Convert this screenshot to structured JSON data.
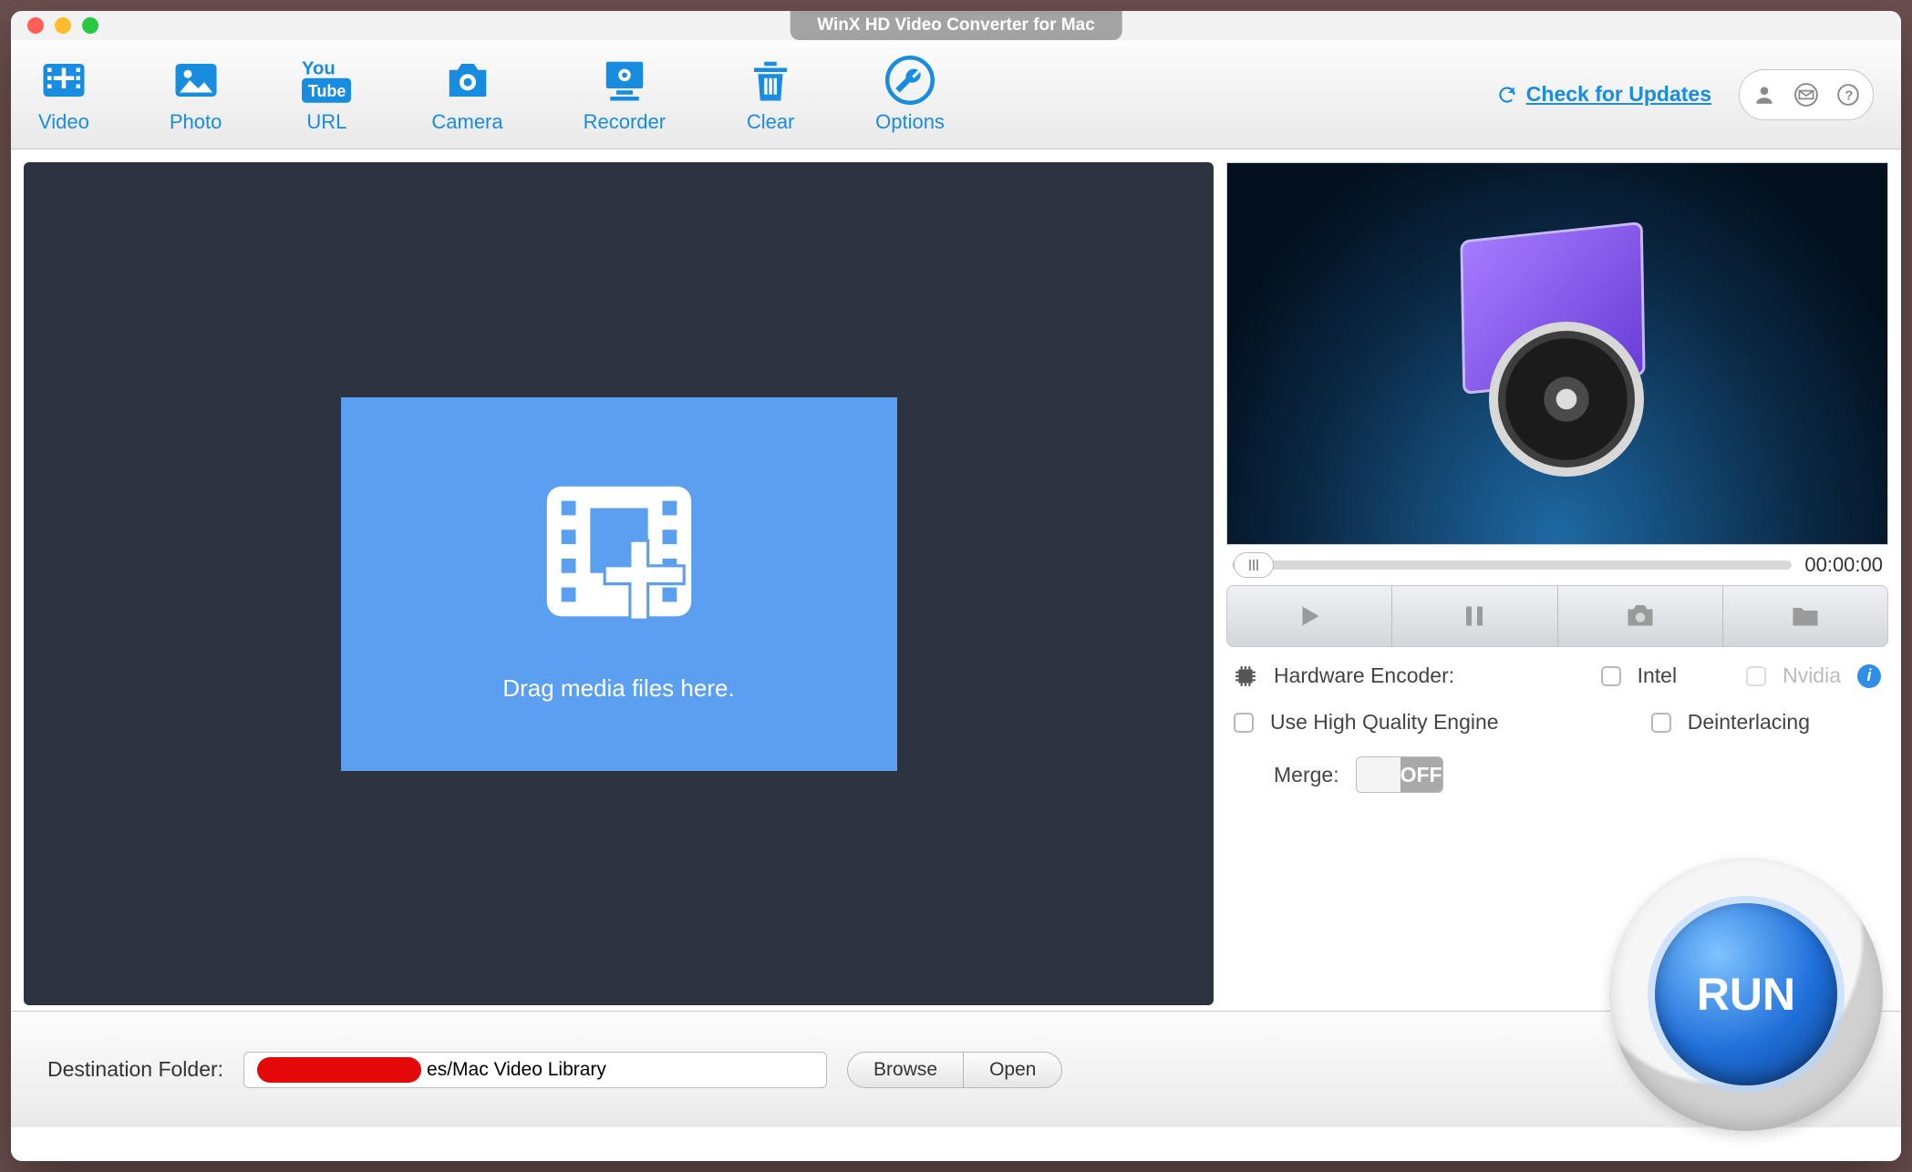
{
  "window": {
    "title": "WinX HD Video Converter for Mac"
  },
  "toolbar": {
    "items": [
      {
        "label": "Video",
        "icon": "video-add-icon"
      },
      {
        "label": "Photo",
        "icon": "photo-icon"
      },
      {
        "label": "URL",
        "icon": "youtube-icon"
      },
      {
        "label": "Camera",
        "icon": "camera-icon"
      },
      {
        "label": "Recorder",
        "icon": "recorder-icon"
      },
      {
        "label": "Clear",
        "icon": "trash-icon"
      },
      {
        "label": "Options",
        "icon": "wrench-icon"
      }
    ],
    "check_updates": "Check for Updates"
  },
  "drop": {
    "hint": "Drag media files here."
  },
  "preview": {
    "time": "00:00:00"
  },
  "encoding": {
    "hw_label": "Hardware Encoder:",
    "intel": "Intel",
    "nvidia": "Nvidia",
    "hq": "Use High Quality Engine",
    "deint": "Deinterlacing",
    "merge_label": "Merge:",
    "merge_state": "OFF"
  },
  "bottom": {
    "dest_label": "Destination Folder:",
    "dest_value": "es/Mac Video Library",
    "browse": "Browse",
    "open": "Open",
    "run": "RUN"
  }
}
